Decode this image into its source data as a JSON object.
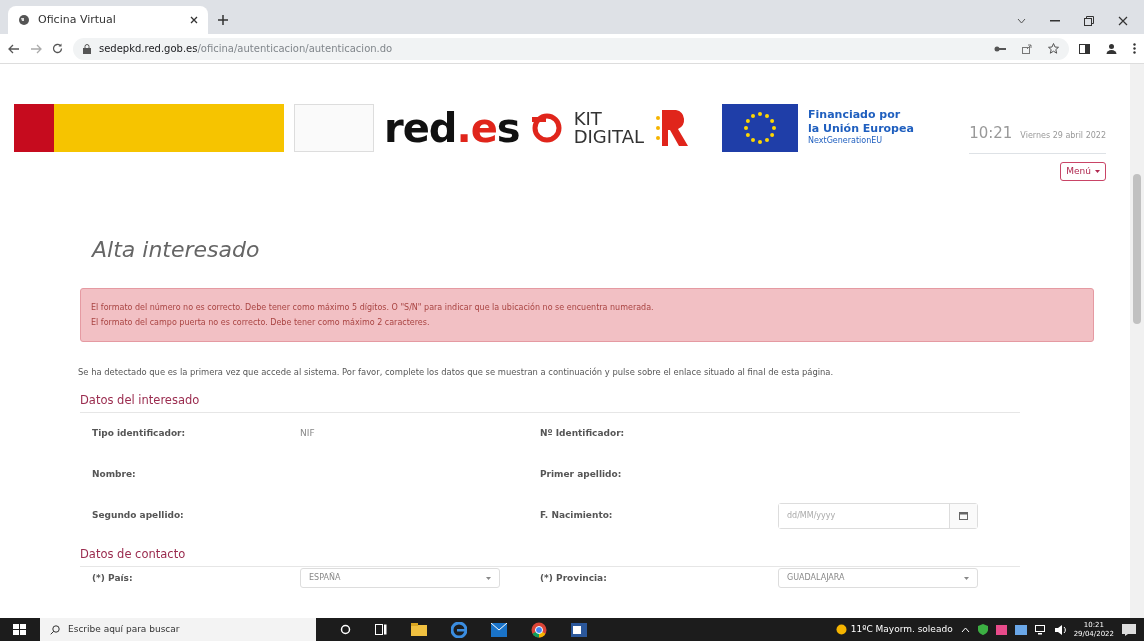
{
  "browser": {
    "tabs": [
      {
        "title": "Oficina Virtual",
        "selected": true
      }
    ],
    "url_host": "sedepkd.red.gob.es",
    "url_path": "/oficina/autenticacion/autenticacion.do"
  },
  "header": {
    "logos": {
      "redes": "red.es",
      "kit_top": "KIT",
      "kit_bottom": "DIGITAL",
      "eu_line1": "Financiado por",
      "eu_line2": "la Unión Europea",
      "eu_line3": "NextGenerationEU"
    },
    "time": "10:21",
    "date": "Viernes 29 abril 2022",
    "menu_button": "Menú"
  },
  "page_title": "Alta interesado",
  "alert_messages": [
    "El formato del número no es correcto. Debe tener como máximo 5 dígitos. O \"S/N\" para indicar que la ubicación no se encuentra numerada.",
    "El formato del campo puerta no es correcto. Debe tener como máximo 2 caracteres."
  ],
  "intro": "Se ha detectado que es la primera vez que accede al sistema. Por favor, complete los datos que se muestran a continuación y pulse sobre el enlace situado al final de esta página.",
  "sections": [
    {
      "title": "Datos del interesado",
      "rows": [
        [
          {
            "label": "Tipo identificador:",
            "kind": "text",
            "value": "NIF"
          },
          {
            "label": "Nº Identificador:",
            "kind": "text"
          }
        ],
        [
          {
            "label": "Nombre:",
            "kind": "text"
          },
          {
            "label": "Primer apellido:",
            "kind": "text"
          }
        ],
        [
          {
            "label": "Segundo apellido:",
            "kind": "text"
          },
          {
            "label": "F. Nacimiento:",
            "kind": "date",
            "placeholder": "dd/MM/yyyy"
          }
        ]
      ]
    },
    {
      "title": "Datos de contacto",
      "rows": [
        [
          {
            "label": "(*) País:",
            "kind": "select",
            "value": "ESPAÑA"
          },
          {
            "label": "(*) Provincia:",
            "kind": "select",
            "value": "GUADALAJARA"
          }
        ]
      ]
    }
  ],
  "taskbar": {
    "search_placeholder": "Escribe aquí para buscar",
    "weather": "11ºC  Mayorm. soleado",
    "time": "10:21",
    "date": "29/04/2022"
  }
}
